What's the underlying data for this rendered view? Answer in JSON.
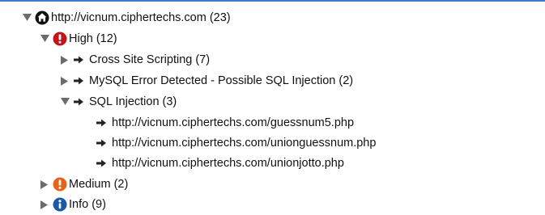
{
  "tree": {
    "root": {
      "label": "http://vicnum.ciphertechs.com (23)",
      "icon": "home-icon"
    },
    "high": {
      "label": "High (12)",
      "icon": "alert-high-icon",
      "color": "#c0151a"
    },
    "xss": {
      "label": "Cross Site Scripting (7)"
    },
    "mysql": {
      "label": "MySQL Error Detected - Possible SQL Injection (2)"
    },
    "sqli": {
      "label": "SQL Injection (3)"
    },
    "urls": [
      {
        "label": "http://vicnum.ciphertechs.com/guessnum5.php"
      },
      {
        "label": "http://vicnum.ciphertechs.com/unionguessnum.php"
      },
      {
        "label": "http://vicnum.ciphertechs.com/unionjotto.php"
      }
    ],
    "medium": {
      "label": "Medium (2)",
      "icon": "alert-medium-icon",
      "color": "#e8631a"
    },
    "info": {
      "label": "Info (9)",
      "icon": "info-icon",
      "color": "#1a5aa8"
    }
  },
  "colors": {
    "accent": "#3b7bc8"
  }
}
